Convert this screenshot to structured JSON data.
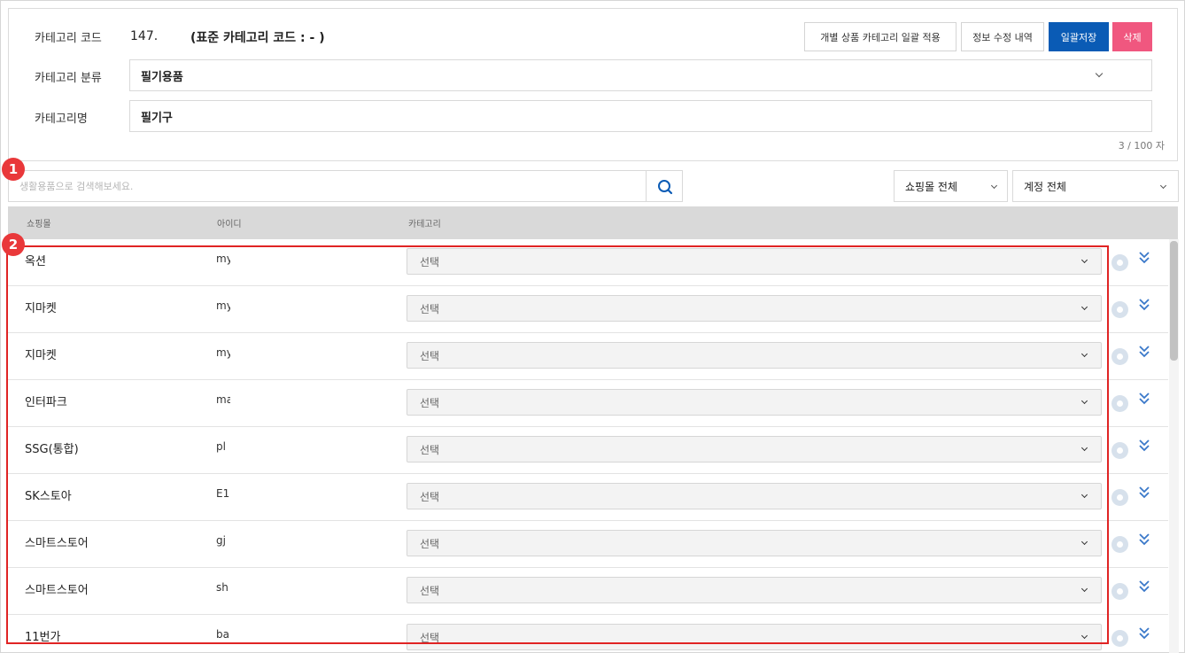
{
  "form": {
    "code_label": "카테고리 코드",
    "code_value": "147.",
    "standard_code": "(표준 카테고리 코드 : - )",
    "classification_label": "카테고리 분류",
    "classification_value": "필기용품",
    "name_label": "카테고리명",
    "name_value": "필기구",
    "char_counter": "3 / 100 자"
  },
  "buttons": {
    "bulk_apply": "개별 상품 카테고리 일괄 적용",
    "edit_history": "정보 수정 내역",
    "save_all": "일괄저장",
    "delete": "삭제"
  },
  "search": {
    "placeholder": "생활용품으로 검색해보세요."
  },
  "filters": {
    "mall": "쇼핑몰 전체",
    "account": "계정 전체"
  },
  "table": {
    "headers": {
      "mall": "쇼핑몰",
      "id": "아이디",
      "category": "카테고리"
    },
    "rows": [
      {
        "mall": "옥션",
        "id": "my",
        "category": "선택"
      },
      {
        "mall": "지마켓",
        "id": "my",
        "category": "선택"
      },
      {
        "mall": "지마켓",
        "id": "my",
        "category": "선택"
      },
      {
        "mall": "인터파크",
        "id": "ma",
        "category": "선택"
      },
      {
        "mall": "SSG(통합)",
        "id": "pl",
        "category": "선택"
      },
      {
        "mall": "SK스토아",
        "id": "E1",
        "category": "선택"
      },
      {
        "mall": "스마트스토어",
        "id": "gj",
        "category": "선택"
      },
      {
        "mall": "스마트스토어",
        "id": "sh",
        "category": "선택"
      },
      {
        "mall": "11번가",
        "id": "ba",
        "category": "선택"
      }
    ]
  },
  "annotations": {
    "badge1": "1",
    "badge2": "2"
  },
  "colors": {
    "primary": "#0a5bb5",
    "danger": "#f0577f",
    "annotation": "#e02424"
  }
}
